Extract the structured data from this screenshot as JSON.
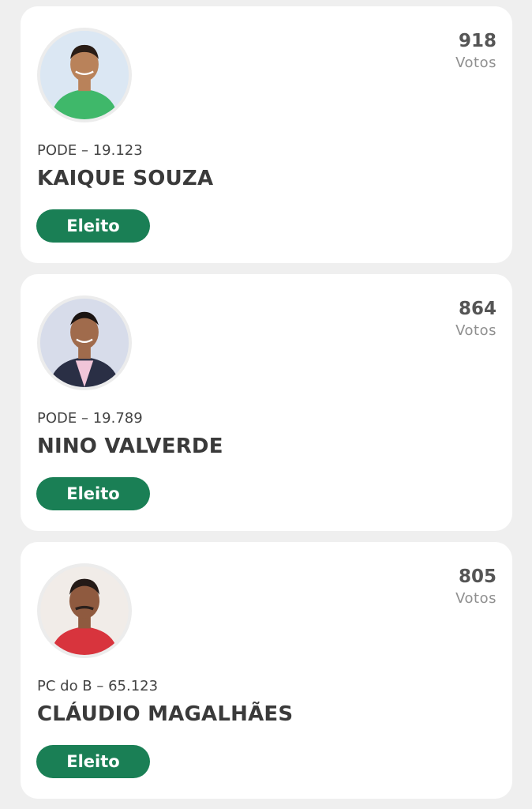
{
  "candidates": [
    {
      "votes": "918",
      "votes_label": "Votos",
      "party": "PODE – 19.123",
      "name": "KAIQUE SOUZA",
      "status": "Eleito",
      "photo": {
        "background": "#dbe7f3",
        "shirt": "#3fb86a",
        "skin": "#b9825a",
        "hair": "#2a1d16"
      }
    },
    {
      "votes": "864",
      "votes_label": "Votos",
      "party": "PODE – 19.789",
      "name": "NINO VALVERDE",
      "status": "Eleito",
      "photo": {
        "background": "#d7dcea",
        "shirt": "#2a2f45",
        "skin": "#a06b4c",
        "hair": "#1b1412"
      }
    },
    {
      "votes": "805",
      "votes_label": "Votos",
      "party": "PC do B – 65.123",
      "name": "CLÁUDIO MAGALHÃES",
      "status": "Eleito",
      "photo": {
        "background": "#f1ece8",
        "shirt": "#d8343d",
        "skin": "#8f5a3f",
        "hair": "#241a17"
      }
    }
  ],
  "colors": {
    "status_badge": "#1a7f55",
    "page_background": "#efefef"
  }
}
